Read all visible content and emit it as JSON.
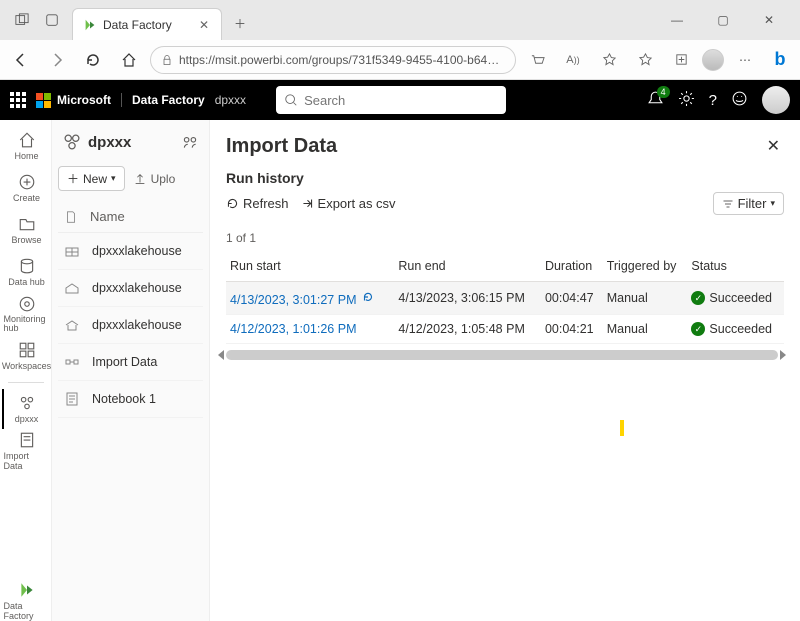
{
  "browser": {
    "tab_title": "Data Factory",
    "url": "https://msit.powerbi.com/groups/731f5349-9455-4100-b643-eae657e298..."
  },
  "header": {
    "brand": "Microsoft",
    "product": "Data Factory",
    "crumb": "dpxxx",
    "search_placeholder": "Search",
    "notif_count": "4"
  },
  "rail": {
    "home": "Home",
    "create": "Create",
    "browse": "Browse",
    "datahub": "Data hub",
    "monitoring": "Monitoring hub",
    "workspaces": "Workspaces",
    "dpxxx": "dpxxx",
    "importdata": "Import Data",
    "datafactory": "Data Factory"
  },
  "nav": {
    "workspace": "dpxxx",
    "new_label": "New",
    "upload_label": "Uplo",
    "col_name": "Name",
    "items": [
      {
        "name": "dpxxxlakehouse"
      },
      {
        "name": "dpxxxlakehouse"
      },
      {
        "name": "dpxxxlakehouse"
      },
      {
        "name": "Import Data"
      },
      {
        "name": "Notebook 1"
      }
    ]
  },
  "panel": {
    "title": "Import Data",
    "subtitle": "Run history",
    "refresh": "Refresh",
    "export": "Export as csv",
    "filter": "Filter",
    "count": "1 of 1",
    "cols": {
      "start": "Run start",
      "end": "Run end",
      "dur": "Duration",
      "trig": "Triggered by",
      "status": "Status"
    },
    "rows": [
      {
        "start": "4/13/2023, 3:01:27 PM",
        "end": "4/13/2023, 3:06:15 PM",
        "dur": "00:04:47",
        "trig": "Manual",
        "status": "Succeeded"
      },
      {
        "start": "4/12/2023, 1:01:26 PM",
        "end": "4/12/2023, 1:05:48 PM",
        "dur": "00:04:21",
        "trig": "Manual",
        "status": "Succeeded"
      }
    ]
  }
}
